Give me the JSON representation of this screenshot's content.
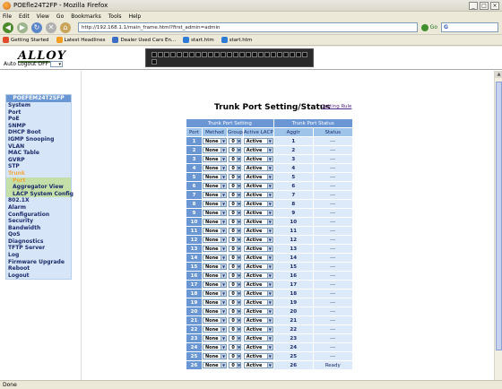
{
  "window": {
    "title": "POEfle24T2FP - Mozilla Firefox",
    "buttons": {
      "minimize": "_",
      "maximize": "□",
      "close": "×"
    }
  },
  "menubar": [
    "File",
    "Edit",
    "View",
    "Go",
    "Bookmarks",
    "Tools",
    "Help"
  ],
  "navbar": {
    "url": "http://192.168.1.1/main_frame.html?first_admin=admin",
    "go_label": "Go",
    "search_placeholder": "G"
  },
  "bookmarks": [
    {
      "label": "Getting Started",
      "color": "#e04b2a"
    },
    {
      "label": "Latest Headlines",
      "color": "#f39c1f"
    },
    {
      "label": "Dealer Used Cars En...",
      "color": "#3b6dc4"
    },
    {
      "label": "start.htm",
      "color": "#2e7bd6"
    },
    {
      "label": "start.htm",
      "color": "#2e7bd6"
    }
  ],
  "header": {
    "logo": "ALLOY",
    "auto_logout_label": "Auto Logout",
    "auto_logout_value": "OFF"
  },
  "sidebar": {
    "title": "POEFEM24T2SFP",
    "items": [
      {
        "label": "System",
        "type": "main"
      },
      {
        "label": "Port",
        "type": "main"
      },
      {
        "label": "PoE",
        "type": "main"
      },
      {
        "label": "SNMP",
        "type": "main"
      },
      {
        "label": "DHCP Boot",
        "type": "main"
      },
      {
        "label": "IGMP Snooping",
        "type": "main"
      },
      {
        "label": "VLAN",
        "type": "main"
      },
      {
        "label": "MAC Table",
        "type": "main"
      },
      {
        "label": "GVRP",
        "type": "main"
      },
      {
        "label": "STP",
        "type": "main"
      },
      {
        "label": "Trunk",
        "type": "active"
      },
      {
        "label": "Port",
        "type": "subsel"
      },
      {
        "label": "Aggregator View",
        "type": "sub"
      },
      {
        "label": "LACP System Config",
        "type": "sub"
      },
      {
        "label": "802.1X",
        "type": "main"
      },
      {
        "label": "Alarm",
        "type": "main"
      },
      {
        "label": "Configuration",
        "type": "main"
      },
      {
        "label": "Security",
        "type": "main"
      },
      {
        "label": "Bandwidth",
        "type": "main"
      },
      {
        "label": "QoS",
        "type": "main"
      },
      {
        "label": "Diagnostics",
        "type": "main"
      },
      {
        "label": "TFTP Server",
        "type": "main"
      },
      {
        "label": "Log",
        "type": "main"
      },
      {
        "label": "Firmware Upgrade",
        "type": "main"
      },
      {
        "label": "Reboot",
        "type": "main"
      },
      {
        "label": "Logout",
        "type": "main"
      }
    ]
  },
  "page": {
    "title": "Trunk Port Setting/Status",
    "help_link": "Setting Rule",
    "group_setting": "Trunk Port Setting",
    "group_status": "Trunk Port Status",
    "columns": [
      "Port",
      "Method",
      "Group",
      "Active LACP",
      "Aggtr",
      "Status"
    ]
  },
  "rows": [
    {
      "port": "1",
      "method": "None",
      "group": "0",
      "lacp": "Active",
      "aggtr": "1",
      "status": "---"
    },
    {
      "port": "2",
      "method": "None",
      "group": "0",
      "lacp": "Active",
      "aggtr": "2",
      "status": "---"
    },
    {
      "port": "3",
      "method": "None",
      "group": "0",
      "lacp": "Active",
      "aggtr": "3",
      "status": "---"
    },
    {
      "port": "4",
      "method": "None",
      "group": "0",
      "lacp": "Active",
      "aggtr": "4",
      "status": "---"
    },
    {
      "port": "5",
      "method": "None",
      "group": "0",
      "lacp": "Active",
      "aggtr": "5",
      "status": "---"
    },
    {
      "port": "6",
      "method": "None",
      "group": "0",
      "lacp": "Active",
      "aggtr": "6",
      "status": "---"
    },
    {
      "port": "7",
      "method": "None",
      "group": "0",
      "lacp": "Active",
      "aggtr": "7",
      "status": "---"
    },
    {
      "port": "8",
      "method": "None",
      "group": "0",
      "lacp": "Active",
      "aggtr": "8",
      "status": "---"
    },
    {
      "port": "9",
      "method": "None",
      "group": "0",
      "lacp": "Active",
      "aggtr": "9",
      "status": "---"
    },
    {
      "port": "10",
      "method": "None",
      "group": "0",
      "lacp": "Active",
      "aggtr": "10",
      "status": "---"
    },
    {
      "port": "11",
      "method": "None",
      "group": "0",
      "lacp": "Active",
      "aggtr": "11",
      "status": "---"
    },
    {
      "port": "12",
      "method": "None",
      "group": "0",
      "lacp": "Active",
      "aggtr": "12",
      "status": "---"
    },
    {
      "port": "13",
      "method": "None",
      "group": "0",
      "lacp": "Active",
      "aggtr": "13",
      "status": "---"
    },
    {
      "port": "14",
      "method": "None",
      "group": "0",
      "lacp": "Active",
      "aggtr": "14",
      "status": "---"
    },
    {
      "port": "15",
      "method": "None",
      "group": "0",
      "lacp": "Active",
      "aggtr": "15",
      "status": "---"
    },
    {
      "port": "16",
      "method": "None",
      "group": "0",
      "lacp": "Active",
      "aggtr": "16",
      "status": "---"
    },
    {
      "port": "17",
      "method": "None",
      "group": "0",
      "lacp": "Active",
      "aggtr": "17",
      "status": "---"
    },
    {
      "port": "18",
      "method": "None",
      "group": "0",
      "lacp": "Active",
      "aggtr": "18",
      "status": "---"
    },
    {
      "port": "19",
      "method": "None",
      "group": "0",
      "lacp": "Active",
      "aggtr": "19",
      "status": "---"
    },
    {
      "port": "20",
      "method": "None",
      "group": "0",
      "lacp": "Active",
      "aggtr": "20",
      "status": "---"
    },
    {
      "port": "21",
      "method": "None",
      "group": "0",
      "lacp": "Active",
      "aggtr": "21",
      "status": "---"
    },
    {
      "port": "22",
      "method": "None",
      "group": "0",
      "lacp": "Active",
      "aggtr": "22",
      "status": "---"
    },
    {
      "port": "23",
      "method": "None",
      "group": "0",
      "lacp": "Active",
      "aggtr": "23",
      "status": "---"
    },
    {
      "port": "24",
      "method": "None",
      "group": "0",
      "lacp": "Active",
      "aggtr": "24",
      "status": "---"
    },
    {
      "port": "25",
      "method": "None",
      "group": "0",
      "lacp": "Active",
      "aggtr": "25",
      "status": "---"
    },
    {
      "port": "26",
      "method": "None",
      "group": "0",
      "lacp": "Active",
      "aggtr": "26",
      "status": "Ready"
    }
  ],
  "statusbar": {
    "text": "Done"
  }
}
